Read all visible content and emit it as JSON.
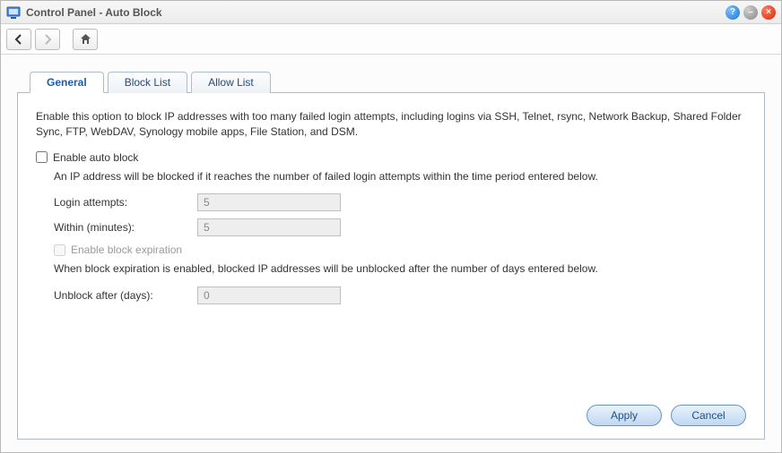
{
  "window": {
    "title": "Control Panel - Auto Block"
  },
  "tabs": {
    "general": "General",
    "blocklist": "Block List",
    "allowlist": "Allow List"
  },
  "general": {
    "description": "Enable this option to block IP addresses with too many failed login attempts, including logins via SSH, Telnet, rsync, Network Backup, Shared Folder Sync, FTP, WebDAV, Synology mobile apps, File Station, and DSM.",
    "enable_auto_block": "Enable auto block",
    "sub_desc": "An IP address will be blocked if it reaches the number of failed login attempts within the time period entered below.",
    "login_attempts_label": "Login attempts:",
    "login_attempts_value": "5",
    "within_label": "Within (minutes):",
    "within_value": "5",
    "enable_expiration": "Enable block expiration",
    "expiration_desc": "When block expiration is enabled, blocked IP addresses will be unblocked after the number of days entered below.",
    "unblock_label": "Unblock after (days):",
    "unblock_value": "0"
  },
  "buttons": {
    "apply": "Apply",
    "cancel": "Cancel"
  }
}
